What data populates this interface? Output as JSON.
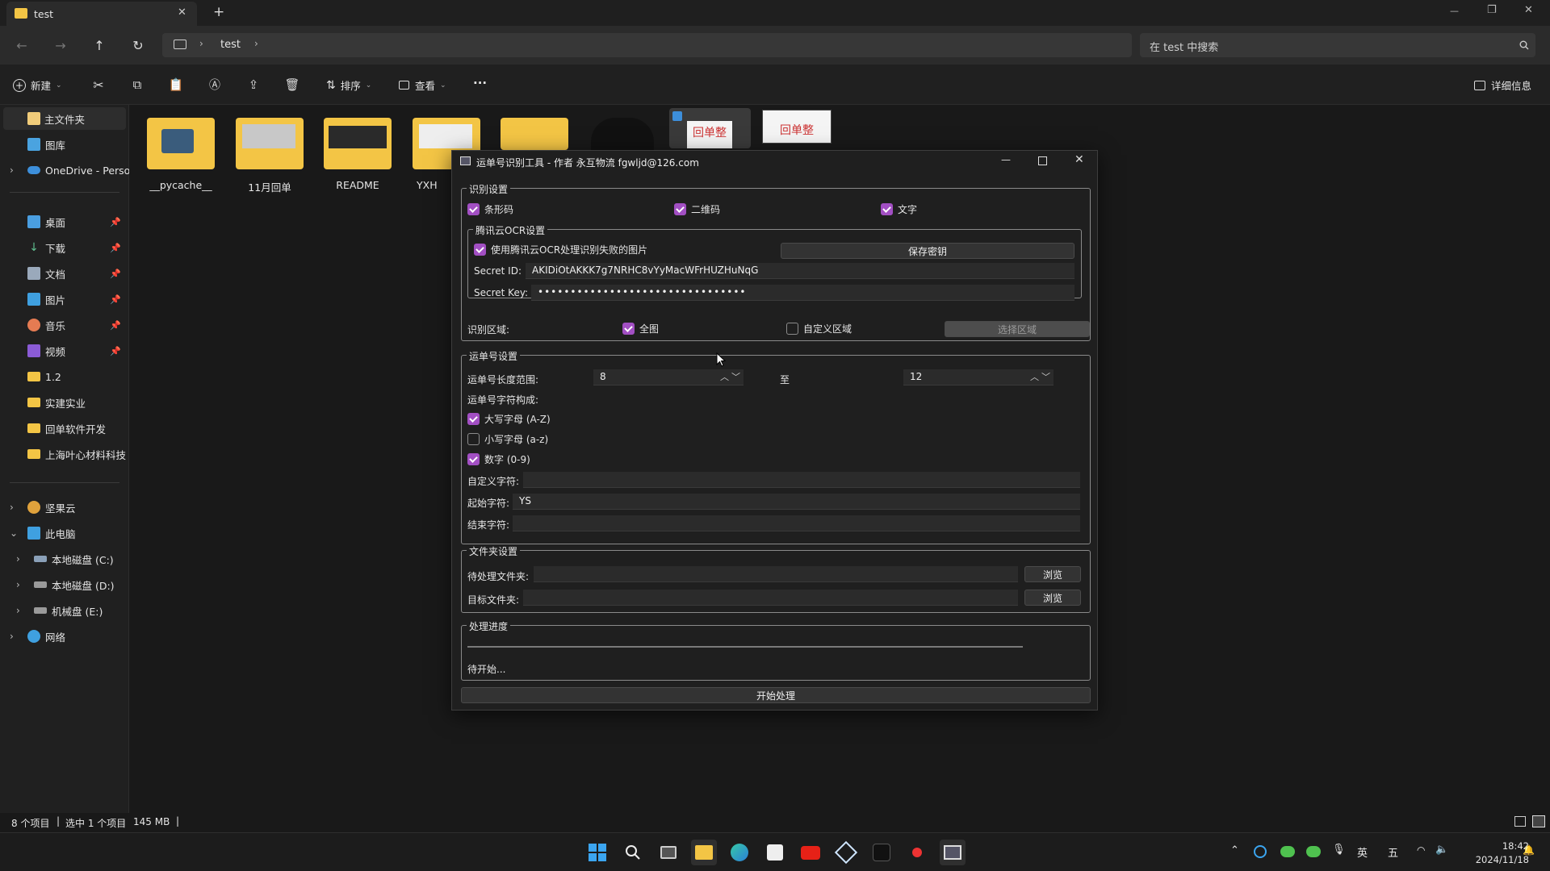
{
  "explorer": {
    "tab_title": "test",
    "tab_close": "✕",
    "tab_add": "+",
    "window_controls": {
      "minimize": "—",
      "maximize": "❐",
      "close": "✕"
    },
    "breadcrumb": [
      "test"
    ],
    "search_placeholder": "在 test 中搜索",
    "toolbar": {
      "new_label": "新建",
      "sort_label": "排序",
      "view_label": "查看",
      "more_label": "···",
      "details_label": "详细信息"
    },
    "sidebar": {
      "top": [
        {
          "label": "主文件夹",
          "icon": "home-icon"
        },
        {
          "label": "图库",
          "icon": "gallery-icon"
        },
        {
          "label": "OneDrive - Perso",
          "icon": "onedrive-icon"
        }
      ],
      "pinned": [
        {
          "label": "桌面",
          "icon": "desktop-icon"
        },
        {
          "label": "下载",
          "icon": "download-icon"
        },
        {
          "label": "文档",
          "icon": "document-icon"
        },
        {
          "label": "图片",
          "icon": "pictures-icon"
        },
        {
          "label": "音乐",
          "icon": "music-icon"
        },
        {
          "label": "视频",
          "icon": "video-icon"
        },
        {
          "label": "1.2",
          "icon": "folder-icon"
        },
        {
          "label": "实建实业",
          "icon": "folder-icon"
        },
        {
          "label": "回单软件开发",
          "icon": "folder-icon"
        },
        {
          "label": "上海叶心材料科技",
          "icon": "folder-icon"
        }
      ],
      "bottom": [
        {
          "label": "坚果云",
          "icon": "nutstore-icon"
        },
        {
          "label": "此电脑",
          "icon": "pc-icon"
        },
        {
          "label": "本地磁盘 (C:)",
          "icon": "drive-icon"
        },
        {
          "label": "本地磁盘 (D:)",
          "icon": "drive-icon"
        },
        {
          "label": "机械盘 (E:)",
          "icon": "drive-icon"
        },
        {
          "label": "网络",
          "icon": "network-icon"
        }
      ]
    },
    "files": [
      {
        "name": "__pycache__"
      },
      {
        "name": "11月回单"
      },
      {
        "name": "README"
      },
      {
        "name": "YXH"
      },
      {
        "name": ""
      },
      {
        "name": ""
      },
      {
        "name": ""
      },
      {
        "name": ""
      }
    ],
    "thumb_text": "回单整",
    "status": {
      "count": "8 个项目",
      "selected": "选中 1 个项目",
      "size": "145 MB"
    }
  },
  "dialog": {
    "title": "运单号识别工具 - 作者 永互物流 fgwljd@126.com",
    "recognize": {
      "group": "识别设置",
      "barcode": {
        "label": "条形码",
        "checked": true
      },
      "qrcode": {
        "label": "二维码",
        "checked": true
      },
      "text": {
        "label": "文字",
        "checked": true
      }
    },
    "ocr": {
      "group": "腾讯云OCR设置",
      "use": {
        "label": "使用腾讯云OCR处理识别失败的图片",
        "checked": true
      },
      "save_button": "保存密钥",
      "secret_id_label": "Secret ID:",
      "secret_id": "AKIDiOtAKKK7g7NRHC8vYyMacWFrHUZHuNqG",
      "secret_key_label": "Secret Key:",
      "secret_key": "••••••••••••••••••••••••••••••••"
    },
    "area": {
      "label": "识别区域:",
      "full": {
        "label": "全图",
        "checked": true
      },
      "custom": {
        "label": "自定义区域",
        "checked": false
      },
      "select_button": "选择区域"
    },
    "waybill": {
      "group": "运单号设置",
      "length_label": "运单号长度范围:",
      "min": "8",
      "to": "至",
      "max": "12",
      "chars_label": "运单号字符构成:",
      "upper": {
        "label": "大写字母 (A-Z)",
        "checked": true
      },
      "lower": {
        "label": "小写字母 (a-z)",
        "checked": false
      },
      "digit": {
        "label": "数字 (0-9)",
        "checked": true
      },
      "custom_label": "自定义字符:",
      "custom_value": "",
      "start_label": "起始字符:",
      "start_value": "YS",
      "end_label": "结束字符:",
      "end_value": ""
    },
    "folders": {
      "group": "文件夹设置",
      "source_label": "待处理文件夹:",
      "source_value": "",
      "target_label": "目标文件夹:",
      "target_value": "",
      "browse": "浏览"
    },
    "progress": {
      "group": "处理进度",
      "value": 0,
      "status": "待开始..."
    },
    "start_button": "开始处理"
  },
  "taskbar": {
    "ime_lang": "英",
    "ime_mode": "五",
    "time": "18:42",
    "date": "2024/11/18"
  }
}
